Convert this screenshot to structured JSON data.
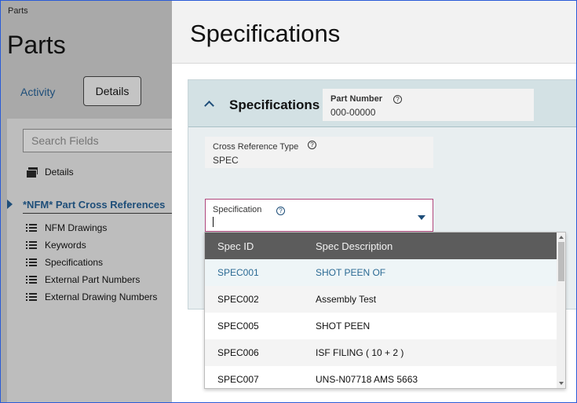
{
  "breadcrumb": "Parts",
  "left": {
    "title": "Parts",
    "tabs": [
      {
        "label": "Activity",
        "active": false
      },
      {
        "label": "Details",
        "active": true
      }
    ],
    "search_placeholder": "Search Fields",
    "details_label": "Details",
    "section_title": "*NFM* Part Cross References",
    "nav_items": [
      {
        "label": "NFM Drawings"
      },
      {
        "label": "Keywords"
      },
      {
        "label": "Specifications"
      },
      {
        "label": "External Part Numbers"
      },
      {
        "label": "External Drawing Numbers"
      }
    ]
  },
  "main": {
    "title": "Specifications",
    "panel": {
      "title": "Specifications",
      "part_number": {
        "label": "Part Number",
        "value": "000-00000"
      },
      "cross_reference_type": {
        "label": "Cross Reference Type",
        "value": "SPEC"
      },
      "specification": {
        "label": "Specification",
        "value": ""
      },
      "help_glyph": "?"
    }
  },
  "dropdown": {
    "columns": [
      "Spec ID",
      "Spec Description"
    ],
    "rows": [
      {
        "id": "SPEC001",
        "description": "SHOT PEEN OF",
        "selected": true
      },
      {
        "id": "SPEC002",
        "description": "Assembly Test",
        "selected": false
      },
      {
        "id": "SPEC005",
        "description": "SHOT PEEN",
        "selected": false
      },
      {
        "id": "SPEC006",
        "description": "ISF FILING ( 10 + 2 )",
        "selected": false
      },
      {
        "id": "SPEC007",
        "description": "UNS-N07718 AMS 5663",
        "selected": false
      }
    ]
  },
  "colors": {
    "accent": "#1e4e79",
    "focus_border": "#b0467c",
    "selected_text": "#2b6a94"
  }
}
